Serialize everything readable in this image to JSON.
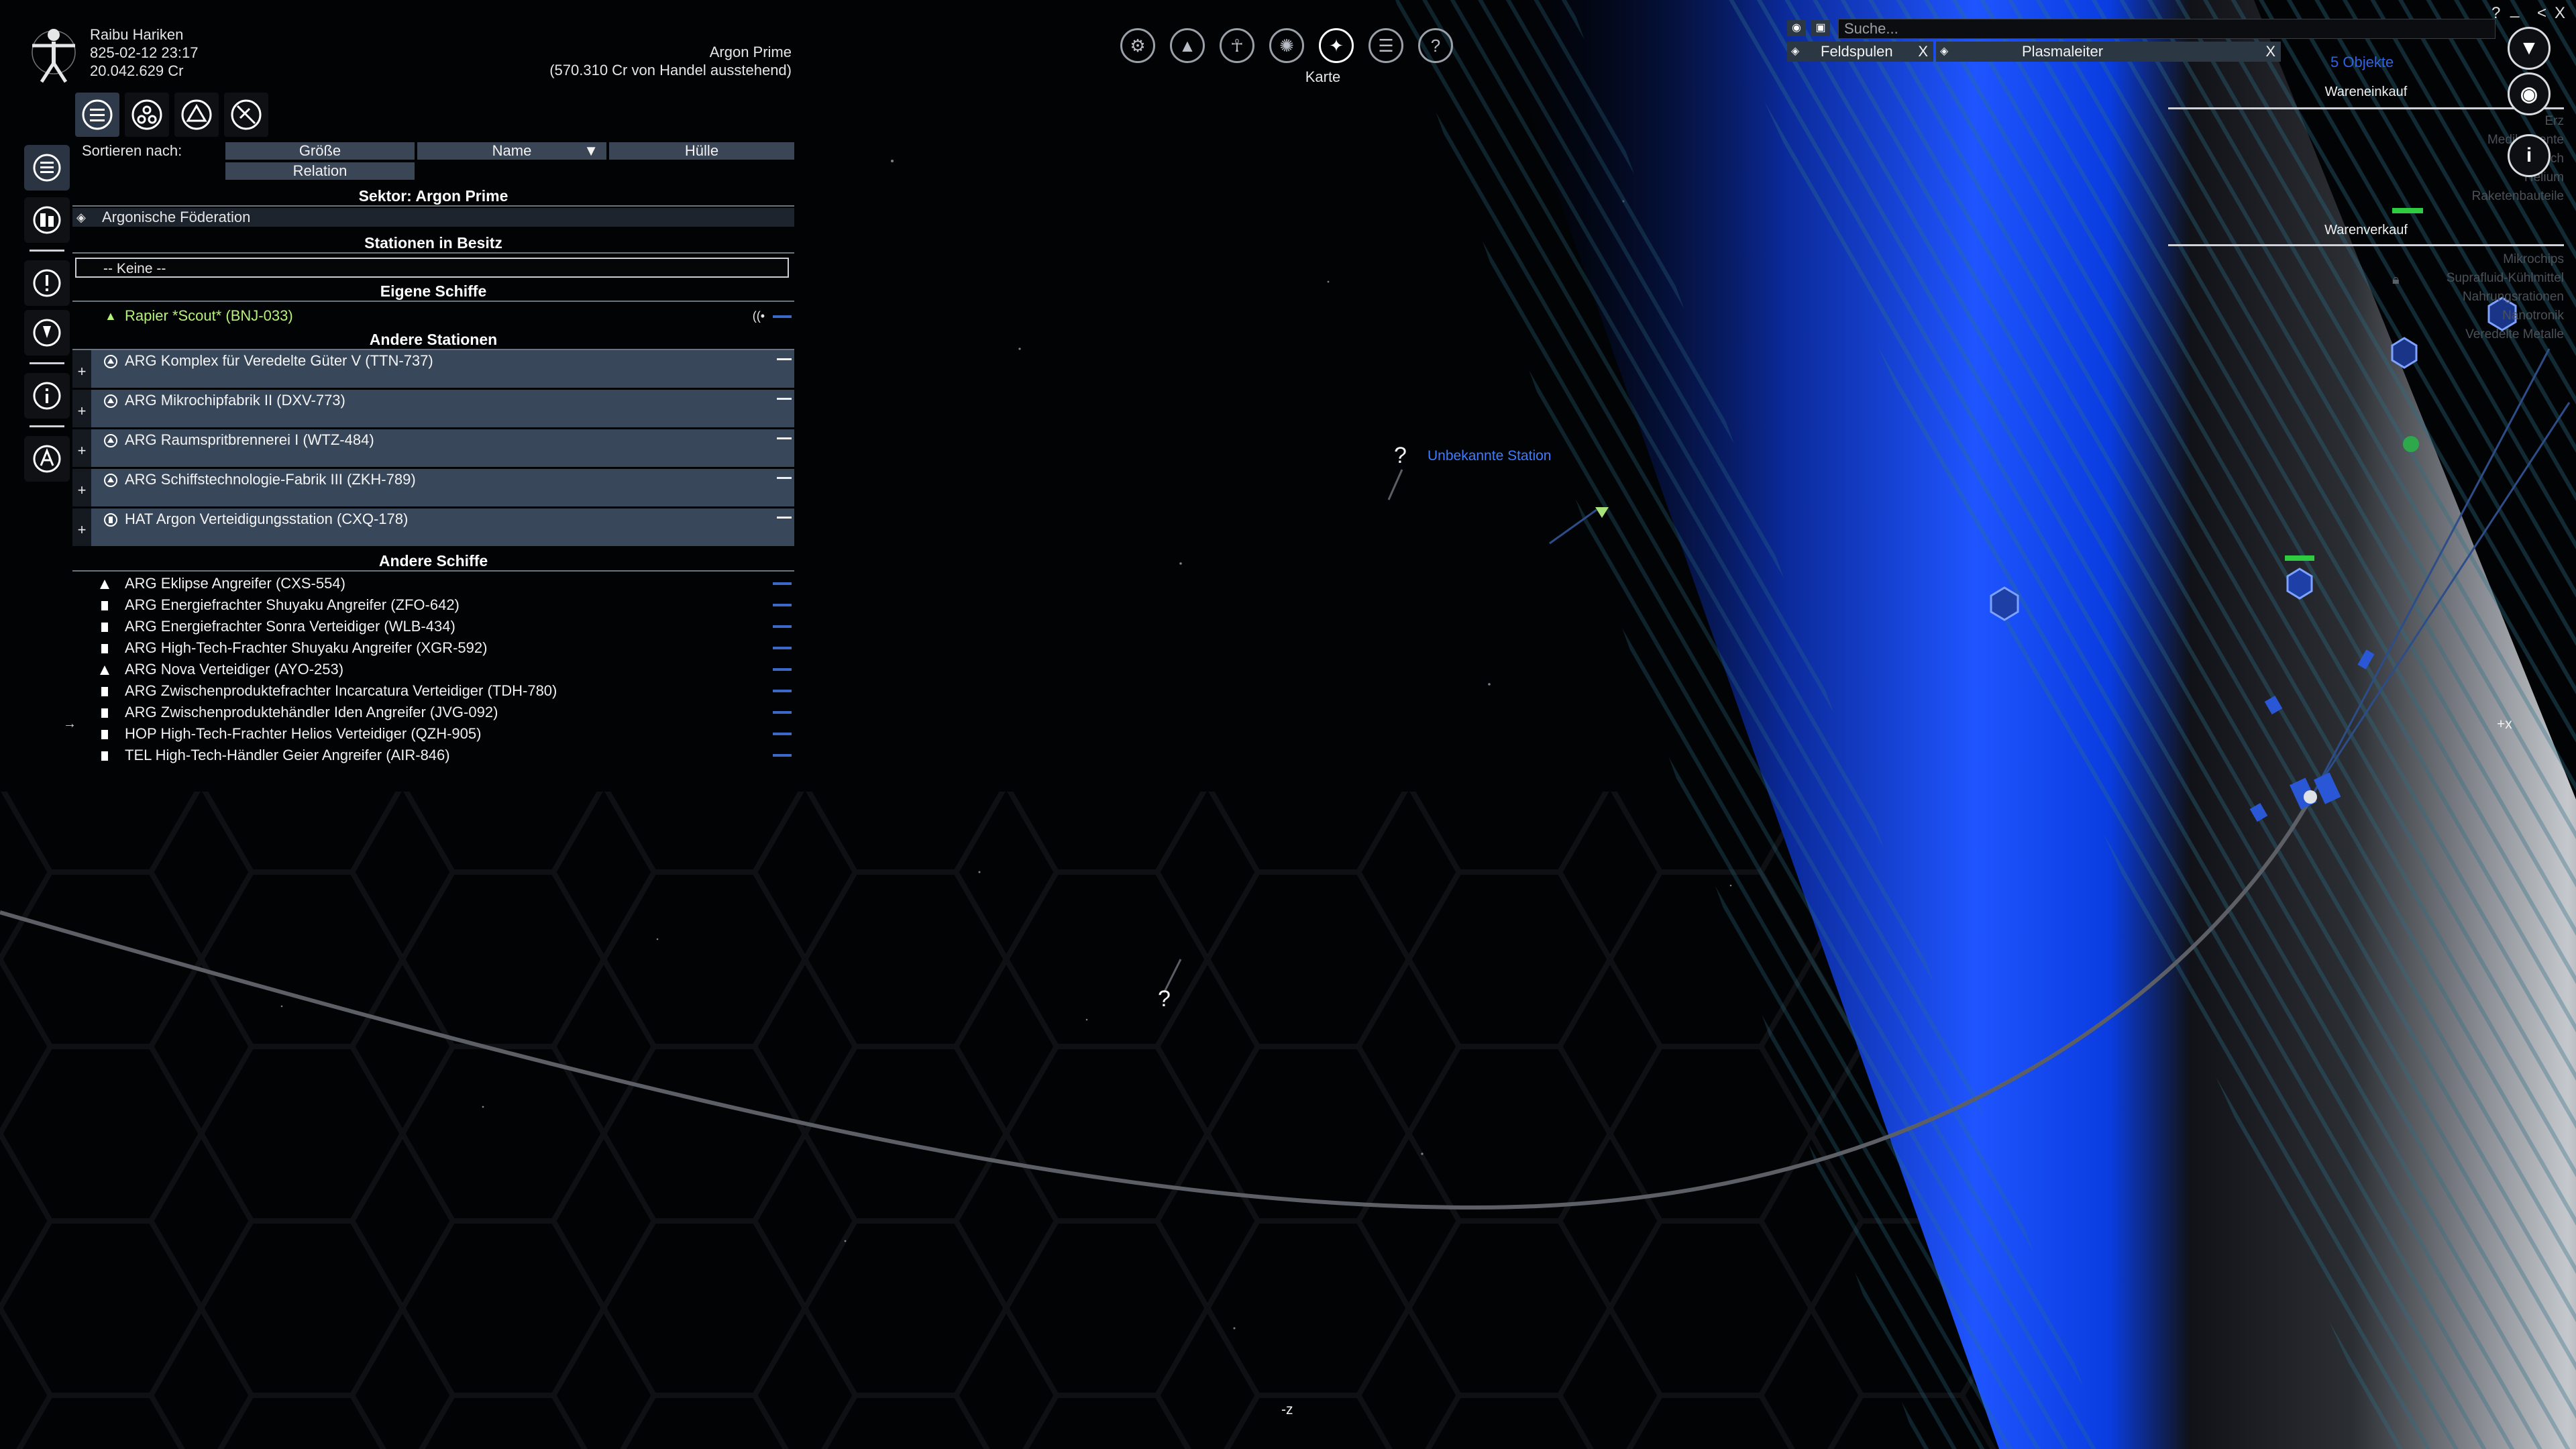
{
  "player": {
    "name": "Raibu Hariken",
    "datetime": "825-02-12 23:17",
    "credits": "20.042.629 Cr",
    "sector": "Argon Prime",
    "trade_pending": "(570.310 Cr von Handel ausstehend)"
  },
  "toolbar": {
    "active_label": "Karte",
    "icons": [
      "settings-icon",
      "ship-icon",
      "player-icon",
      "globe-icon",
      "map-icon",
      "encyclopedia-icon",
      "help-icon"
    ]
  },
  "property": {
    "sort_label": "Sortieren nach:",
    "sort_options": [
      "Größe",
      "Name",
      "Hülle",
      "Relation"
    ],
    "sector_title": "Sektor: Argon Prime",
    "faction": "Argonische Föderation",
    "owned_stations_title": "Stationen in Besitz",
    "owned_stations_none": "-- Keine --",
    "own_ships_title": "Eigene Schiffe",
    "own_ships": [
      {
        "name": "Rapier *Scout* (BNJ-033)"
      }
    ],
    "other_stations_title": "Andere Stationen",
    "other_stations": [
      {
        "name": "ARG Komplex für Veredelte Güter V (TTN-737)"
      },
      {
        "name": "ARG Mikrochipfabrik II (DXV-773)"
      },
      {
        "name": "ARG Raumspritbrennerei I (WTZ-484)"
      },
      {
        "name": "ARG Schiffstechnologie-Fabrik III (ZKH-789)"
      },
      {
        "name": "HAT Argon Verteidigungsstation (CXQ-178)"
      }
    ],
    "other_ships_title": "Andere Schiffe",
    "other_ships": [
      {
        "name": "ARG Eklipse Angreifer (CXS-554)",
        "icon": "triangle"
      },
      {
        "name": "ARG Energiefrachter Shuyaku Angreifer (ZFO-642)",
        "icon": "freighter"
      },
      {
        "name": "ARG Energiefrachter Sonra Verteidiger (WLB-434)",
        "icon": "freighter"
      },
      {
        "name": "ARG High-Tech-Frachter Shuyaku Angreifer (XGR-592)",
        "icon": "freighter"
      },
      {
        "name": "ARG Nova Verteidiger (AYO-253)",
        "icon": "triangle"
      },
      {
        "name": "ARG Zwischenproduktefrachter Incarcatura Verteidiger (TDH-780)",
        "icon": "freighter"
      },
      {
        "name": "ARG Zwischenproduktehändler Iden Angreifer (JVG-092)",
        "icon": "freighter"
      },
      {
        "name": "HOP High-Tech-Frachter Helios Verteidiger (QZH-905)",
        "icon": "freighter"
      },
      {
        "name": "TEL High-Tech-Händler Geier Angreifer (AIR-846)",
        "icon": "freighter"
      }
    ]
  },
  "filters": {
    "search_placeholder": "Suche...",
    "chips": [
      {
        "label": "Feldspulen",
        "close": "X"
      },
      {
        "label": "Plasmaleiter",
        "close": "X"
      }
    ],
    "objects_count": "5 Objekte"
  },
  "wares": {
    "buy_title": "Wareneinkauf",
    "buy": [
      "Erz",
      "Medikamente",
      "Fleisch",
      "Helium",
      "Raketenbauteile"
    ],
    "sell_title": "Warenverkauf",
    "sell": [
      "Mikrochips",
      "Suprafluid-Kühlmittel",
      "Nahrungsrationen",
      "Nanotronik",
      "Veredelte Metalle"
    ]
  },
  "map": {
    "unknown_station": "Unbekannte Station",
    "unknown_mark": "?",
    "axis_x": "+x",
    "axis_z": "-z",
    "left_marker": "→"
  },
  "window": {
    "help": "?",
    "minimize": "_",
    "back": "<",
    "close": "X"
  }
}
